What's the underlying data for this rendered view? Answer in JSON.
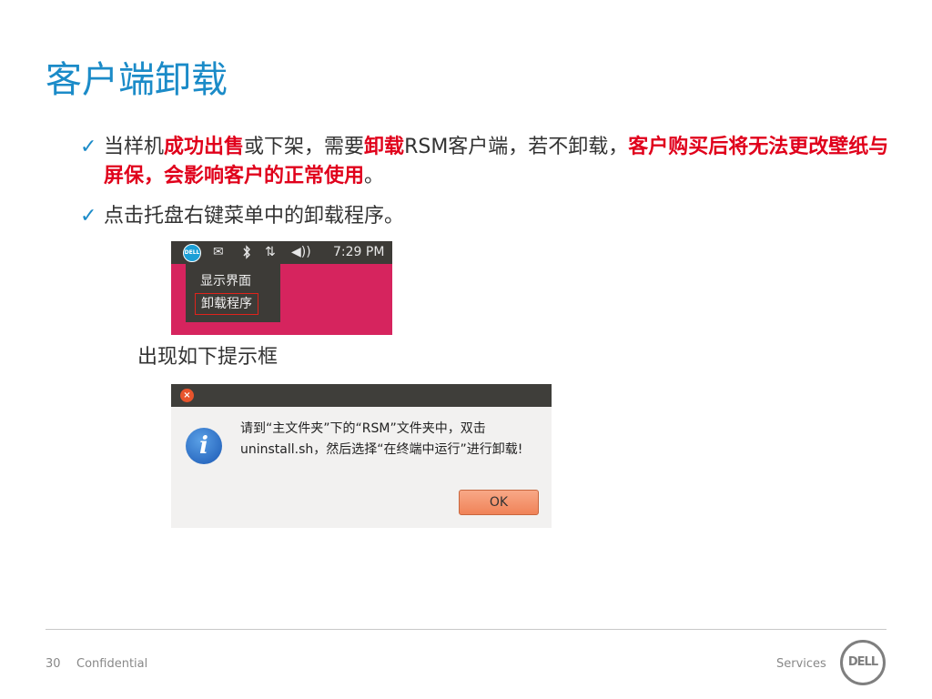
{
  "title": "客户端卸载",
  "bullets": [
    {
      "check": "✓",
      "parts": [
        {
          "text": "当样机",
          "red": false
        },
        {
          "text": "成功出售",
          "red": true
        },
        {
          "text": "或下架，需要",
          "red": false
        },
        {
          "text": "卸载",
          "red": true
        },
        {
          "text": "RSM客户端，若不卸载，",
          "red": false
        },
        {
          "text": "客户购买后将无法更改壁纸与屏保，会影响客户的正常使用",
          "red": true
        },
        {
          "text": "。",
          "red": false
        }
      ]
    },
    {
      "check": "✓",
      "parts": [
        {
          "text": "点击托盘右键菜单中的卸载程序。",
          "red": false
        }
      ]
    }
  ],
  "tray": {
    "dell_logo": "DELL",
    "icons": [
      "mail-icon",
      "bluetooth-icon",
      "network-icon",
      "volume-icon"
    ],
    "time": "7:29 PM",
    "menu_items": [
      "显示界面",
      "卸载程序"
    ]
  },
  "caption": "出现如下提示框",
  "dialog": {
    "message_line1": "请到“主文件夹”下的“RSM”文件夹中，双击",
    "message_line2": "uninstall.sh，然后选择“在终端中运行”进行卸载!",
    "ok_label": "OK"
  },
  "footer": {
    "page_number": "30",
    "confidential": "Confidential",
    "services": "Services",
    "logo": "DELL"
  },
  "colors": {
    "title": "#1b8bc8",
    "highlight": "#e0001b",
    "tray_background": "#d6245e"
  }
}
